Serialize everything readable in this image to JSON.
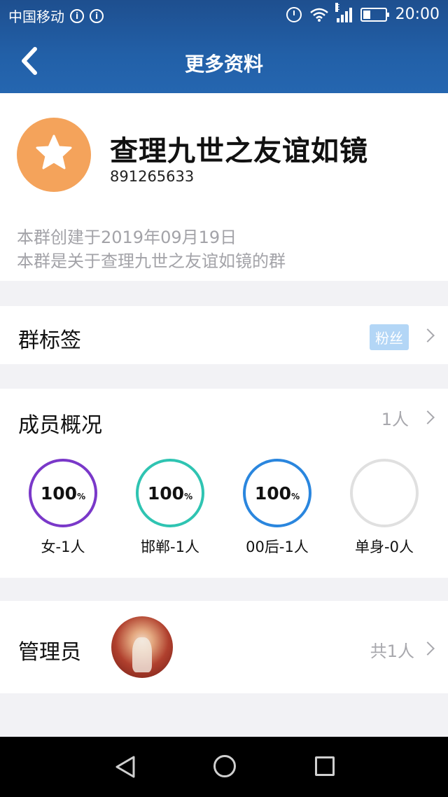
{
  "statusbar": {
    "carrier": "中国移动",
    "network_type": "E",
    "time": "20:00"
  },
  "nav": {
    "title": "更多资料"
  },
  "group": {
    "name": "查理九世之友谊如镜",
    "id": "891265633",
    "created": "本群创建于2019年09月19日",
    "about": "本群是关于查理九世之友谊如镜的群"
  },
  "tags": {
    "label": "群标签",
    "badge": "粉丝"
  },
  "members": {
    "label": "成员概况",
    "count": "1人",
    "stats": [
      {
        "value": "100",
        "unit": "%",
        "label": "女-1人",
        "color": "#7a38c9"
      },
      {
        "value": "100",
        "unit": "%",
        "label": "邯郸-1人",
        "color": "#2fc4b2"
      },
      {
        "value": "100",
        "unit": "%",
        "label": "00后-1人",
        "color": "#2a86de"
      },
      {
        "value": "",
        "unit": "",
        "label": "单身-0人",
        "color": "#e0e0e0"
      }
    ]
  },
  "admin": {
    "label": "管理员",
    "count": "共1人"
  },
  "colors": {
    "header": "#2260a8",
    "avatar": "#f4a35b",
    "tag_badge": "#b3d6f6"
  },
  "icons": {
    "back": "chevron-left-icon",
    "avatar": "star-icon",
    "sysnav": [
      "triangle-back-icon",
      "circle-home-icon",
      "square-recent-icon"
    ]
  }
}
